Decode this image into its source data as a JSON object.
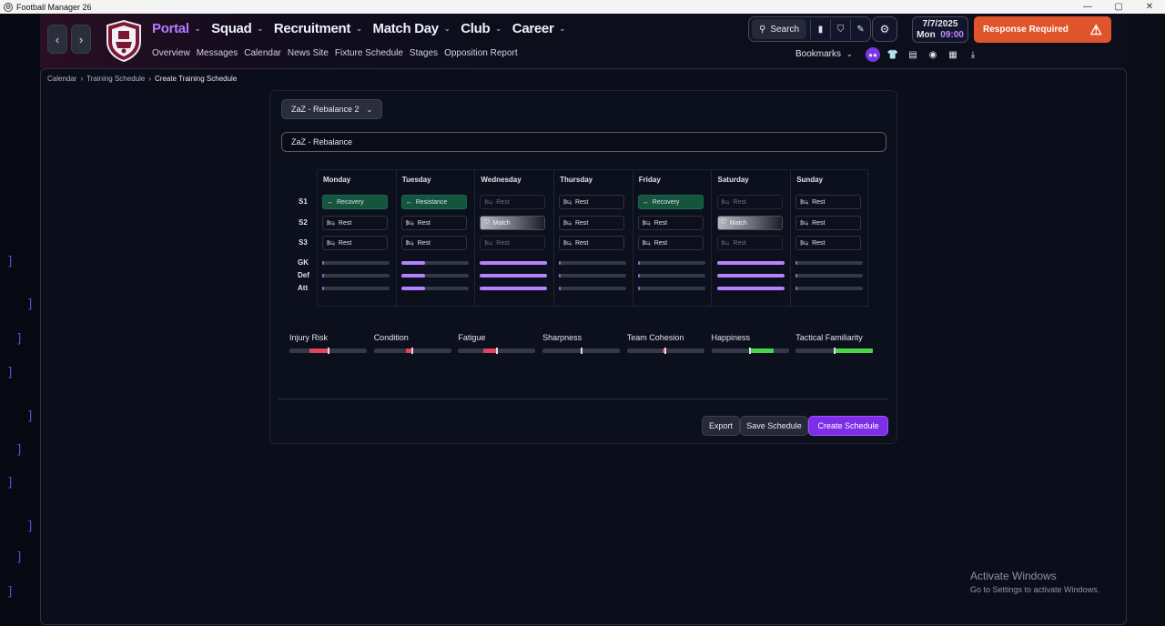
{
  "window": {
    "title": "Football Manager 26",
    "controls": [
      "—",
      "▢",
      "✕"
    ]
  },
  "header": {
    "nav_back": "‹",
    "nav_forward": "›",
    "main_nav": [
      {
        "label": "Portal",
        "active": true
      },
      {
        "label": "Squad",
        "active": false
      },
      {
        "label": "Recruitment",
        "active": false
      },
      {
        "label": "Match Day",
        "active": false
      },
      {
        "label": "Club",
        "active": false
      },
      {
        "label": "Career",
        "active": false
      }
    ],
    "sub_nav": [
      "Overview",
      "Messages",
      "Calendar",
      "News Site",
      "Fixture Schedule",
      "Stages",
      "Opposition Report"
    ],
    "search_label": "Search",
    "date": "7/7/2025",
    "day": "Mon",
    "time": "09:00",
    "alert_label": "Response Required",
    "bookmarks_label": "Bookmarks"
  },
  "breadcrumb": [
    "Calendar",
    "Training Schedule",
    "Create Training Schedule"
  ],
  "schedule": {
    "preset_label": "ZaZ - Rebalance 2",
    "name_value": "ZaZ - Rebalance",
    "session_labels": [
      "S1",
      "S2",
      "S3"
    ],
    "unit_labels": [
      "GK",
      "Def",
      "Att"
    ],
    "days": [
      {
        "name": "Monday",
        "sessions": [
          {
            "label": "Recovery",
            "type": "recovery"
          },
          {
            "label": "Rest",
            "type": "rest"
          },
          {
            "label": "Rest",
            "type": "rest"
          }
        ],
        "load": [
          0.03,
          0.03,
          0.03
        ]
      },
      {
        "name": "Tuesday",
        "sessions": [
          {
            "label": "Resistance",
            "type": "resistance"
          },
          {
            "label": "Rest",
            "type": "rest"
          },
          {
            "label": "Rest",
            "type": "rest"
          }
        ],
        "load": [
          0.36,
          0.36,
          0.36
        ]
      },
      {
        "name": "Wednesday",
        "sessions": [
          {
            "label": "Rest",
            "type": "dim"
          },
          {
            "label": "Match",
            "type": "match"
          },
          {
            "label": "Rest",
            "type": "dim"
          }
        ],
        "load": [
          1.0,
          1.0,
          1.0
        ]
      },
      {
        "name": "Thursday",
        "sessions": [
          {
            "label": "Rest",
            "type": "rest"
          },
          {
            "label": "Rest",
            "type": "rest"
          },
          {
            "label": "Rest",
            "type": "rest"
          }
        ],
        "load": [
          0.03,
          0.03,
          0.03
        ]
      },
      {
        "name": "Friday",
        "sessions": [
          {
            "label": "Recovery",
            "type": "recovery"
          },
          {
            "label": "Rest",
            "type": "rest"
          },
          {
            "label": "Rest",
            "type": "rest"
          }
        ],
        "load": [
          0.03,
          0.03,
          0.03
        ]
      },
      {
        "name": "Saturday",
        "sessions": [
          {
            "label": "Rest",
            "type": "dim"
          },
          {
            "label": "Match",
            "type": "match"
          },
          {
            "label": "Rest",
            "type": "dim"
          }
        ],
        "load": [
          1.0,
          1.0,
          1.0
        ]
      },
      {
        "name": "Sunday",
        "sessions": [
          {
            "label": "Rest",
            "type": "rest"
          },
          {
            "label": "Rest",
            "type": "rest"
          },
          {
            "label": "Rest",
            "type": "rest"
          }
        ],
        "load": [
          0.03,
          0.03,
          0.03
        ]
      }
    ],
    "metrics": [
      {
        "label": "Injury Risk",
        "from": 0.26,
        "to": 0.5,
        "color": "#e2445c"
      },
      {
        "label": "Condition",
        "from": 0.42,
        "to": 0.5,
        "color": "#e2445c"
      },
      {
        "label": "Fatigue",
        "from": 0.33,
        "to": 0.5,
        "color": "#e2445c"
      },
      {
        "label": "Sharpness",
        "from": 0.49,
        "to": 0.51,
        "color": "#e0a040"
      },
      {
        "label": "Team Cohesion",
        "from": 0.46,
        "to": 0.5,
        "color": "#e2445c"
      },
      {
        "label": "Happiness",
        "from": 0.5,
        "to": 0.8,
        "color": "#4ad44a"
      },
      {
        "label": "Tactical Familiarity",
        "from": 0.5,
        "to": 1.0,
        "color": "#4ad44a"
      }
    ],
    "buttons": {
      "export": "Export",
      "save": "Save Schedule",
      "create": "Create Schedule"
    }
  },
  "watermark": {
    "line1": "Activate Windows",
    "line2": "Go to Settings to activate Windows."
  },
  "colors": {
    "accent": "#b77bff",
    "alert": "#e0542b",
    "primary_button": "#7d2ee6",
    "load_bar": "#b582ff"
  }
}
